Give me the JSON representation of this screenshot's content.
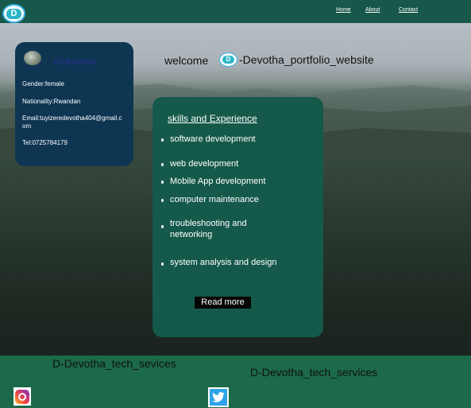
{
  "nav": {
    "logo_letter": "D",
    "links": [
      "Home",
      "About",
      "Contact"
    ]
  },
  "header": {
    "welcome": "welcome",
    "site_name": "-Devotha_portfolio_website"
  },
  "profile": {
    "name": "D-DEVOTHA",
    "gender": "Gender:female",
    "nationality": "Nationality:Rwandan",
    "email": "Email:tuyizeredevotha404@gmail.com",
    "tel": "Tel:0725784179"
  },
  "skills": {
    "title": "skills and Experience",
    "items": [
      "software development",
      "web development",
      "Mobile App development",
      "computer maintenance",
      "troubleshooting and networking",
      "system analysis and design"
    ],
    "read_more": "Read more"
  },
  "footer": {
    "left_text": "D-Devotha_tech_sevices",
    "right_text": "D-Devotha_tech_services"
  },
  "icons": {
    "logo": "d-logo-icon",
    "instagram": "instagram-icon",
    "twitter": "twitter-icon"
  },
  "colors": {
    "nav_bg": "#17584a",
    "footer_bg": "#1c6a49",
    "profile_card_bg": "#0e3552",
    "skills_card_bg": "#15594a",
    "accent": "#39b3e0"
  }
}
